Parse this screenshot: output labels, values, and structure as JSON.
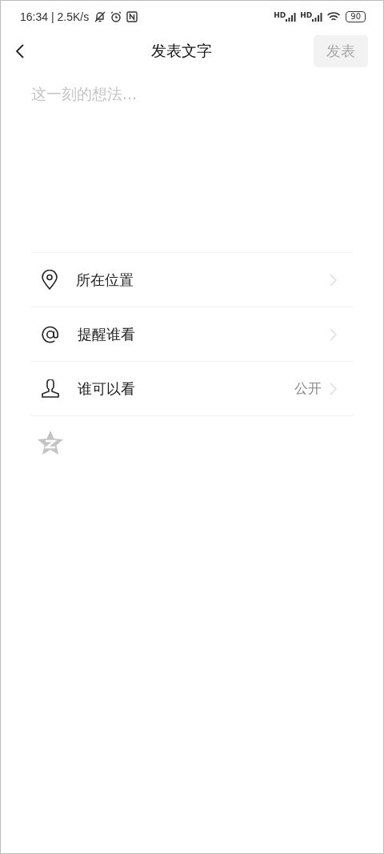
{
  "status_bar": {
    "time_speed": "16:34 | 2.5K/s",
    "signals": [
      {
        "label": "HD"
      },
      {
        "label": "HD"
      }
    ],
    "battery": "90"
  },
  "header": {
    "title": "发表文字",
    "publish": {
      "label": "发表",
      "disabled": true
    }
  },
  "composer": {
    "placeholder": "这一刻的想法..."
  },
  "options": [
    {
      "kind": "location",
      "label": "所在位置"
    },
    {
      "kind": "mention",
      "label": "提醒谁看"
    },
    {
      "kind": "audience",
      "label": "谁可以看",
      "value": "公开"
    }
  ],
  "qzone_sync": {
    "on": false
  }
}
